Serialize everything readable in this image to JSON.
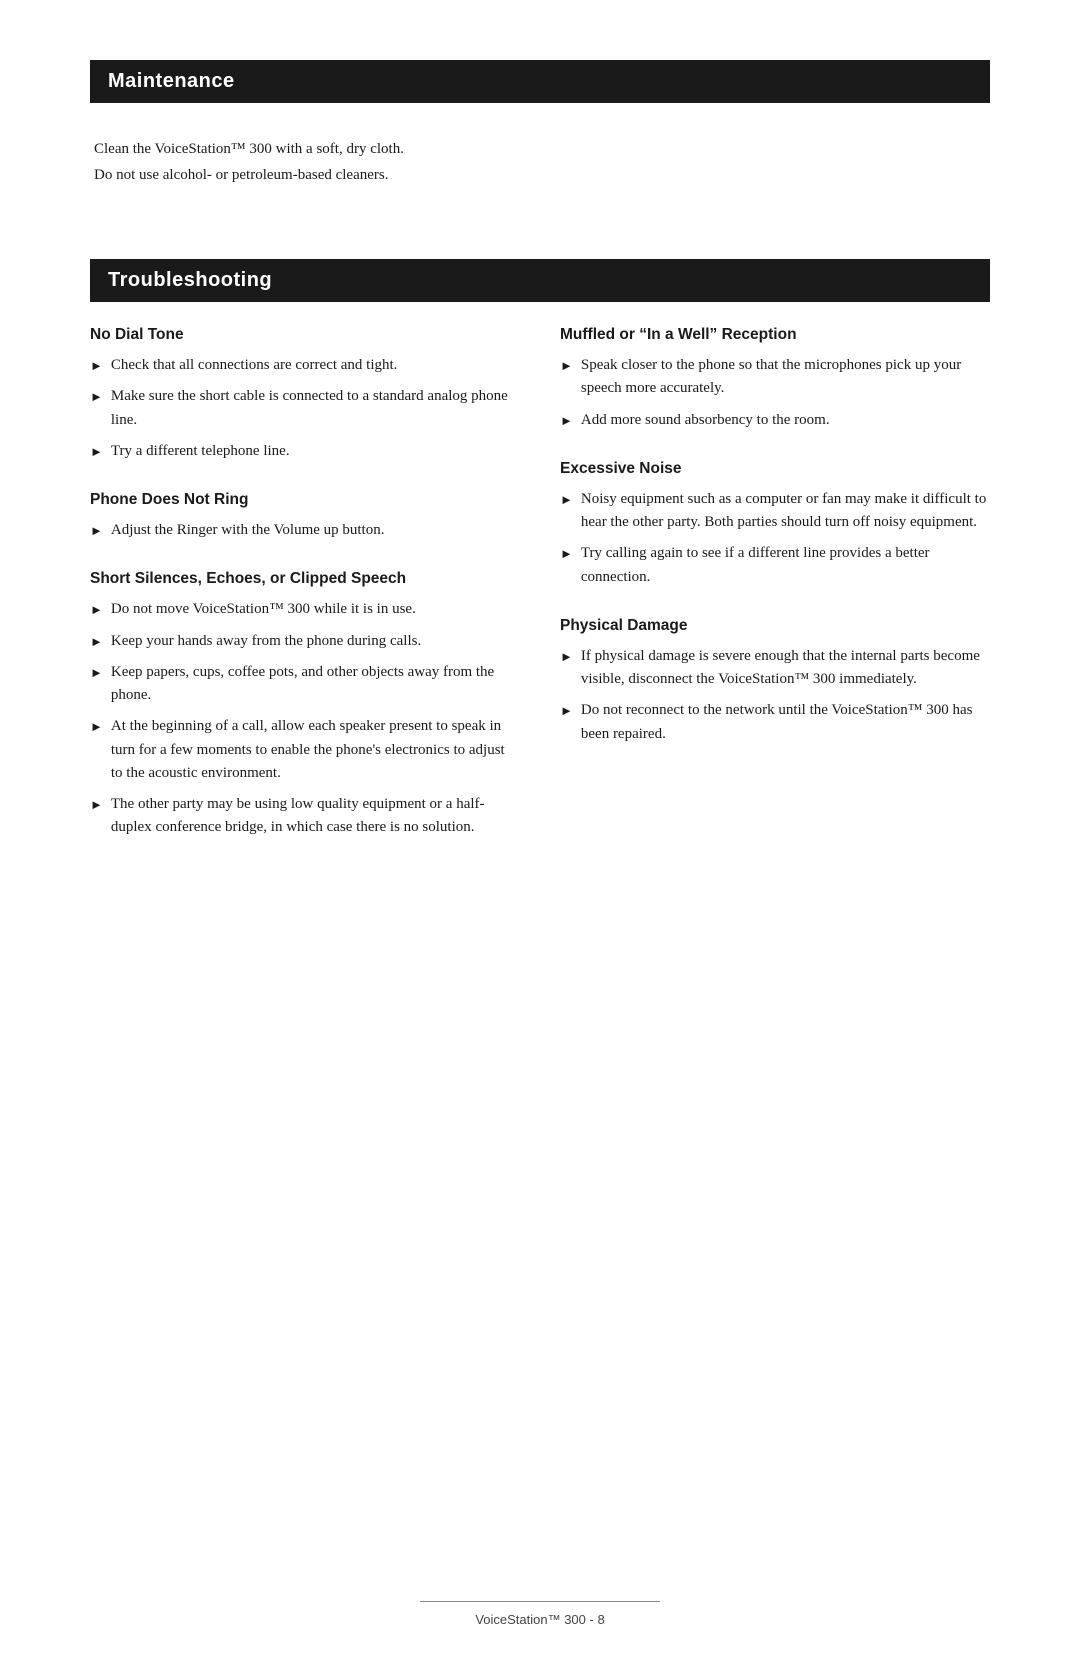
{
  "maintenance": {
    "header": "Maintenance",
    "lines": [
      "Clean the VoiceStation™ 300 with a soft, dry cloth.",
      "Do not use alcohol- or petroleum-based cleaners."
    ]
  },
  "troubleshooting": {
    "header": "Troubleshooting",
    "left_column": [
      {
        "title": "No Dial Tone",
        "bullets": [
          "Check that all connections are correct and tight.",
          "Make sure the short cable is connected to a standard analog phone line.",
          "Try a different telephone line."
        ]
      },
      {
        "title": "Phone Does Not Ring",
        "bullets": [
          "Adjust the Ringer with the Volume up button."
        ]
      },
      {
        "title": "Short Silences, Echoes, or Clipped Speech",
        "bullets": [
          "Do not move VoiceStation™ 300 while it is in use.",
          "Keep your hands away from the phone during calls.",
          "Keep papers, cups, coffee pots, and other objects away from the phone.",
          "At the beginning of a call, allow each speaker present to speak in turn for a few moments to enable the phone's electronics to adjust to the acoustic environment.",
          "The other party may be using low quality equipment or a half-duplex conference bridge, in which case there is no solution."
        ]
      }
    ],
    "right_column": [
      {
        "title": "Muffled or “In a Well” Reception",
        "bullets": [
          "Speak closer to the phone so that the microphones pick up your speech more accurately.",
          "Add more sound absorbency to the room."
        ]
      },
      {
        "title": "Excessive Noise",
        "bullets": [
          "Noisy equipment such as a computer or fan may make it difficult to hear the other party.  Both parties should turn off noisy equipment.",
          "Try calling again to see if a different line provides a better connection."
        ]
      },
      {
        "title": "Physical Damage",
        "bullets": [
          "If physical damage is severe enough that the internal parts become visible, disconnect the VoiceStation™ 300 immediately.",
          "Do not reconnect to the network until the VoiceStation™ 300 has been repaired."
        ]
      }
    ]
  },
  "footer": {
    "text": "VoiceStation™ 300 - 8"
  }
}
